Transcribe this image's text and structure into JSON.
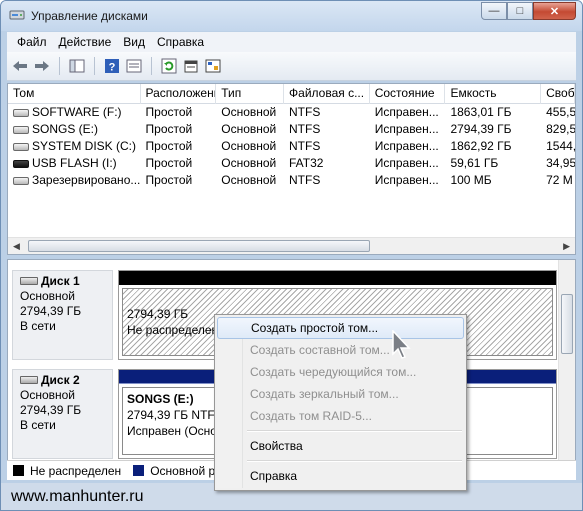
{
  "window": {
    "title": "Управление дисками",
    "min": "—",
    "max": "□",
    "close": "✕"
  },
  "menu": [
    "Файл",
    "Действие",
    "Вид",
    "Справка"
  ],
  "toolbar": [
    "back-icon",
    "forward-icon",
    "console-icon",
    "help-icon",
    "panel-icon",
    "refresh-icon",
    "properties-icon",
    "settings-icon"
  ],
  "list": {
    "columns": [
      "Том",
      "Расположение",
      "Тип",
      "Файловая с...",
      "Состояние",
      "Емкость",
      "Своб"
    ],
    "rows": [
      {
        "name": "SOFTWARE (F:)",
        "layout": "Простой",
        "type": "Основной",
        "fs": "NTFS",
        "status": "Исправен...",
        "capacity": "1863,01 ГБ",
        "free": "455,5"
      },
      {
        "name": "SONGS (E:)",
        "layout": "Простой",
        "type": "Основной",
        "fs": "NTFS",
        "status": "Исправен...",
        "capacity": "2794,39 ГБ",
        "free": "829,5"
      },
      {
        "name": "SYSTEM DISK (C:)",
        "layout": "Простой",
        "type": "Основной",
        "fs": "NTFS",
        "status": "Исправен...",
        "capacity": "1862,92 ГБ",
        "free": "1544,"
      },
      {
        "name": "USB FLASH (I:)",
        "layout": "Простой",
        "type": "Основной",
        "fs": "FAT32",
        "status": "Исправен...",
        "capacity": "59,61 ГБ",
        "free": "34,95"
      },
      {
        "name": "Зарезервировано...",
        "layout": "Простой",
        "type": "Основной",
        "fs": "NTFS",
        "status": "Исправен...",
        "capacity": "100 МБ",
        "free": "72 М"
      }
    ]
  },
  "disks": [
    {
      "name": "Диск 1",
      "type": "Основной",
      "size": "2794,39 ГБ",
      "state": "В сети",
      "partition": {
        "line1": "",
        "line2": "2794,39 ГБ",
        "line3": "Не распределен"
      }
    },
    {
      "name": "Диск 2",
      "type": "Основной",
      "size": "2794,39 ГБ",
      "state": "В сети",
      "partition": {
        "line1": "SONGS  (E:)",
        "line2": "2794,39 ГБ NTFS",
        "line3": "Исправен (Осно"
      }
    }
  ],
  "legend": [
    {
      "label": "Не распределен",
      "color": "#000000"
    },
    {
      "label": "Основной ра",
      "color": "#0a1f7a"
    }
  ],
  "context_menu": {
    "items": [
      {
        "label": "Создать простой том...",
        "enabled": true,
        "highlighted": true
      },
      {
        "label": "Создать составной том...",
        "enabled": false
      },
      {
        "label": "Создать чередующийся том...",
        "enabled": false
      },
      {
        "label": "Создать зеркальный том...",
        "enabled": false
      },
      {
        "label": "Создать том RAID-5...",
        "enabled": false
      },
      {
        "label": "Свойства",
        "enabled": true
      },
      {
        "label": "Справка",
        "enabled": true
      }
    ]
  },
  "statusbar": {
    "text": "www.manhunter.ru"
  }
}
